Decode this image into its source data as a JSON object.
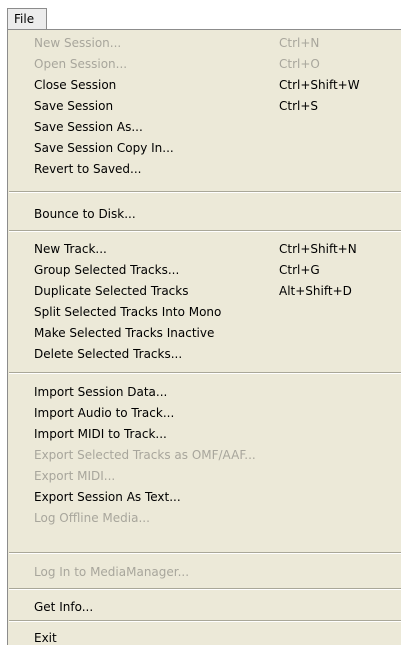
{
  "menubar": {
    "title": "File"
  },
  "menu": {
    "items": [
      {
        "label": "New Session...",
        "shortcut": "Ctrl+N",
        "enabled": false
      },
      {
        "label": "Open Session...",
        "shortcut": "Ctrl+O",
        "enabled": false
      },
      {
        "label": "Close Session",
        "shortcut": "Ctrl+Shift+W",
        "enabled": true
      },
      {
        "label": "Save Session",
        "shortcut": "Ctrl+S",
        "enabled": true
      },
      {
        "label": "Save Session As...",
        "shortcut": "",
        "enabled": true
      },
      {
        "label": "Save Session Copy In...",
        "shortcut": "",
        "enabled": true
      },
      {
        "label": "Revert to Saved...",
        "shortcut": "",
        "enabled": true
      },
      {
        "label": "Bounce to Disk...",
        "shortcut": "",
        "enabled": true
      },
      {
        "label": "New Track...",
        "shortcut": "Ctrl+Shift+N",
        "enabled": true
      },
      {
        "label": "Group Selected Tracks...",
        "shortcut": "Ctrl+G",
        "enabled": true
      },
      {
        "label": "Duplicate Selected Tracks",
        "shortcut": "Alt+Shift+D",
        "enabled": true
      },
      {
        "label": "Split Selected Tracks Into Mono",
        "shortcut": "",
        "enabled": true
      },
      {
        "label": "Make Selected Tracks Inactive",
        "shortcut": "",
        "enabled": true
      },
      {
        "label": "Delete Selected Tracks...",
        "shortcut": "",
        "enabled": true
      },
      {
        "label": "Import Session Data...",
        "shortcut": "",
        "enabled": true
      },
      {
        "label": "Import Audio to Track...",
        "shortcut": "",
        "enabled": true
      },
      {
        "label": "Import MIDI to Track...",
        "shortcut": "",
        "enabled": true
      },
      {
        "label": "Export Selected Tracks as OMF/AAF...",
        "shortcut": "",
        "enabled": false
      },
      {
        "label": "Export MIDI...",
        "shortcut": "",
        "enabled": false
      },
      {
        "label": "Export Session As Text...",
        "shortcut": "",
        "enabled": true
      },
      {
        "label": "Log Offline Media...",
        "shortcut": "",
        "enabled": false
      },
      {
        "label": "Log In to MediaManager...",
        "shortcut": "",
        "enabled": false
      },
      {
        "label": "Get Info...",
        "shortcut": "",
        "enabled": true
      },
      {
        "label": "Exit",
        "shortcut": "",
        "enabled": true
      }
    ]
  }
}
